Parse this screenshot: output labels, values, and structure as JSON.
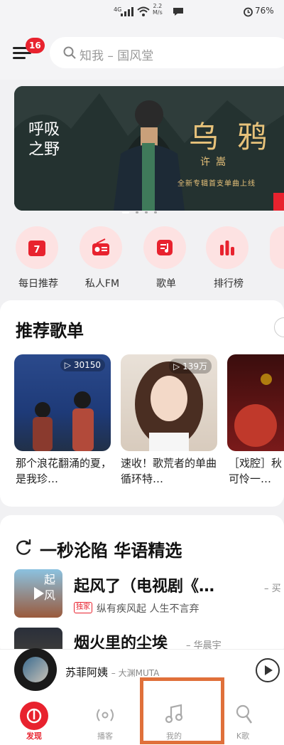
{
  "status": {
    "signal": "4G",
    "speed_value": "2.2",
    "speed_unit": "M/s",
    "battery": "76%"
  },
  "header": {
    "notification_badge": "16",
    "search_placeholder": "知我 – 国风堂"
  },
  "banner": {
    "left_title": "呼吸之野",
    "right_title": "乌鸦",
    "artist": "许嵩",
    "tagline": "全新专辑首支单曲上线"
  },
  "quick_entries": [
    {
      "label": "每日推荐",
      "icon": "calendar-icon",
      "icon_text": "7"
    },
    {
      "label": "私人FM",
      "icon": "radio-icon"
    },
    {
      "label": "歌单",
      "icon": "playlist-icon"
    },
    {
      "label": "排行榜",
      "icon": "chart-icon"
    }
  ],
  "recommended": {
    "title": "推荐歌单",
    "playlists": [
      {
        "count": "30150",
        "title": "那个浪花翻涌的夏，是我珍…"
      },
      {
        "count": "139万",
        "title": "速收！歌荒者的单曲循环特…"
      },
      {
        "count": "",
        "title": "［戏腔］秋 可怜一…"
      }
    ]
  },
  "song_section": {
    "title": "一秒沦陷 华语精选",
    "songs": [
      {
        "title": "起风了（电视剧《…",
        "artist": "– 买",
        "tag": "独家",
        "subtitle": "纵有疾风起 人生不言弃",
        "cover_text": "起风"
      },
      {
        "title": "烟火里的尘埃",
        "artist": "– 华晨宇"
      }
    ]
  },
  "player": {
    "title": "苏菲阿姨",
    "artist": "– 大渊MUTA"
  },
  "tabs": [
    {
      "label": "发现",
      "icon": "netease-logo-icon",
      "active": true
    },
    {
      "label": "播客",
      "icon": "podcast-icon"
    },
    {
      "label": "我的",
      "icon": "music-note-icon"
    },
    {
      "label": "K歌",
      "icon": "karaoke-mic-icon"
    }
  ],
  "colors": {
    "accent": "#e8222e",
    "highlight_box": "#e0703a"
  }
}
